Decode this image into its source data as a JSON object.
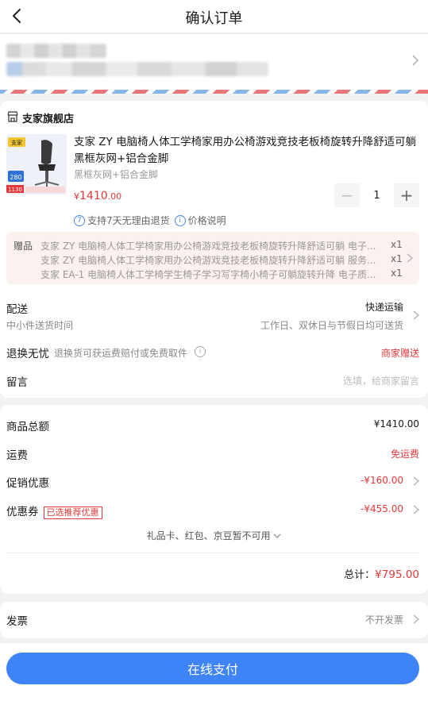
{
  "header": {
    "title": "确认订单"
  },
  "shop": {
    "name": "支家旗舰店",
    "product": {
      "title": "支家 ZY 电脑椅人体工学椅家用办公椅游戏竞技老板椅旋转升降舒适可躺 黑框灰网+铝合金脚",
      "spec": "黑框灰网+铝合金脚",
      "price_symbol": "¥",
      "price_int": "1410",
      "price_dec": ".00",
      "quantity": "1",
      "tag_return_num": "7",
      "tag_return": "支持7天无理由退货",
      "tag_price_icon": "i",
      "tag_price": "价格说明",
      "img_brand": "支家",
      "img_price": "280",
      "img_badge": "1130"
    },
    "gifts": {
      "label": "赠品",
      "items": [
        {
          "name": "支家 ZY 电脑椅人体工学椅家用办公椅游戏竞技老板椅旋转升降舒适可躺 电子...",
          "qty": "x1"
        },
        {
          "name": "支家 ZY 电脑椅人体工学椅家用办公椅游戏竞技老板椅旋转升降舒适可躺 服务...",
          "qty": "x1"
        },
        {
          "name": "支家 EA-1 电脑椅人体工学椅学生椅子学习写字椅小椅子可躺旋转升降 电子质...",
          "qty": "x1"
        }
      ]
    },
    "delivery": {
      "label": "配送",
      "method": "快递运输",
      "sub": "中小件送货时间",
      "time": "工作日、双休日与节假日均可送货"
    },
    "return": {
      "label": "退换无忧",
      "desc": "退换货可获运费赔付或免费取件",
      "info_icon": "i",
      "value": "商家赠送"
    },
    "message": {
      "label": "留言",
      "placeholder": "选填，给商家留言"
    }
  },
  "summary": {
    "total_goods_label": "商品总额",
    "total_goods": "¥1410.00",
    "shipping_label": "运费",
    "shipping": "免运费",
    "promo_label": "促销优惠",
    "promo": "-¥160.00",
    "coupon_label": "优惠券",
    "coupon_tag": "已选推荐优惠",
    "coupon": "-¥455.00",
    "unavailable": "礼品卡、红包、京豆暂不可用",
    "grand_label": "总计：",
    "grand": "¥795.00"
  },
  "invoice": {
    "label": "发票",
    "value": "不开发票"
  },
  "pay": {
    "button": "在线支付"
  },
  "colors": {
    "accent": "#3f84f6",
    "price_red": "#e4393c",
    "gift_bg": "#fbf1ef"
  }
}
